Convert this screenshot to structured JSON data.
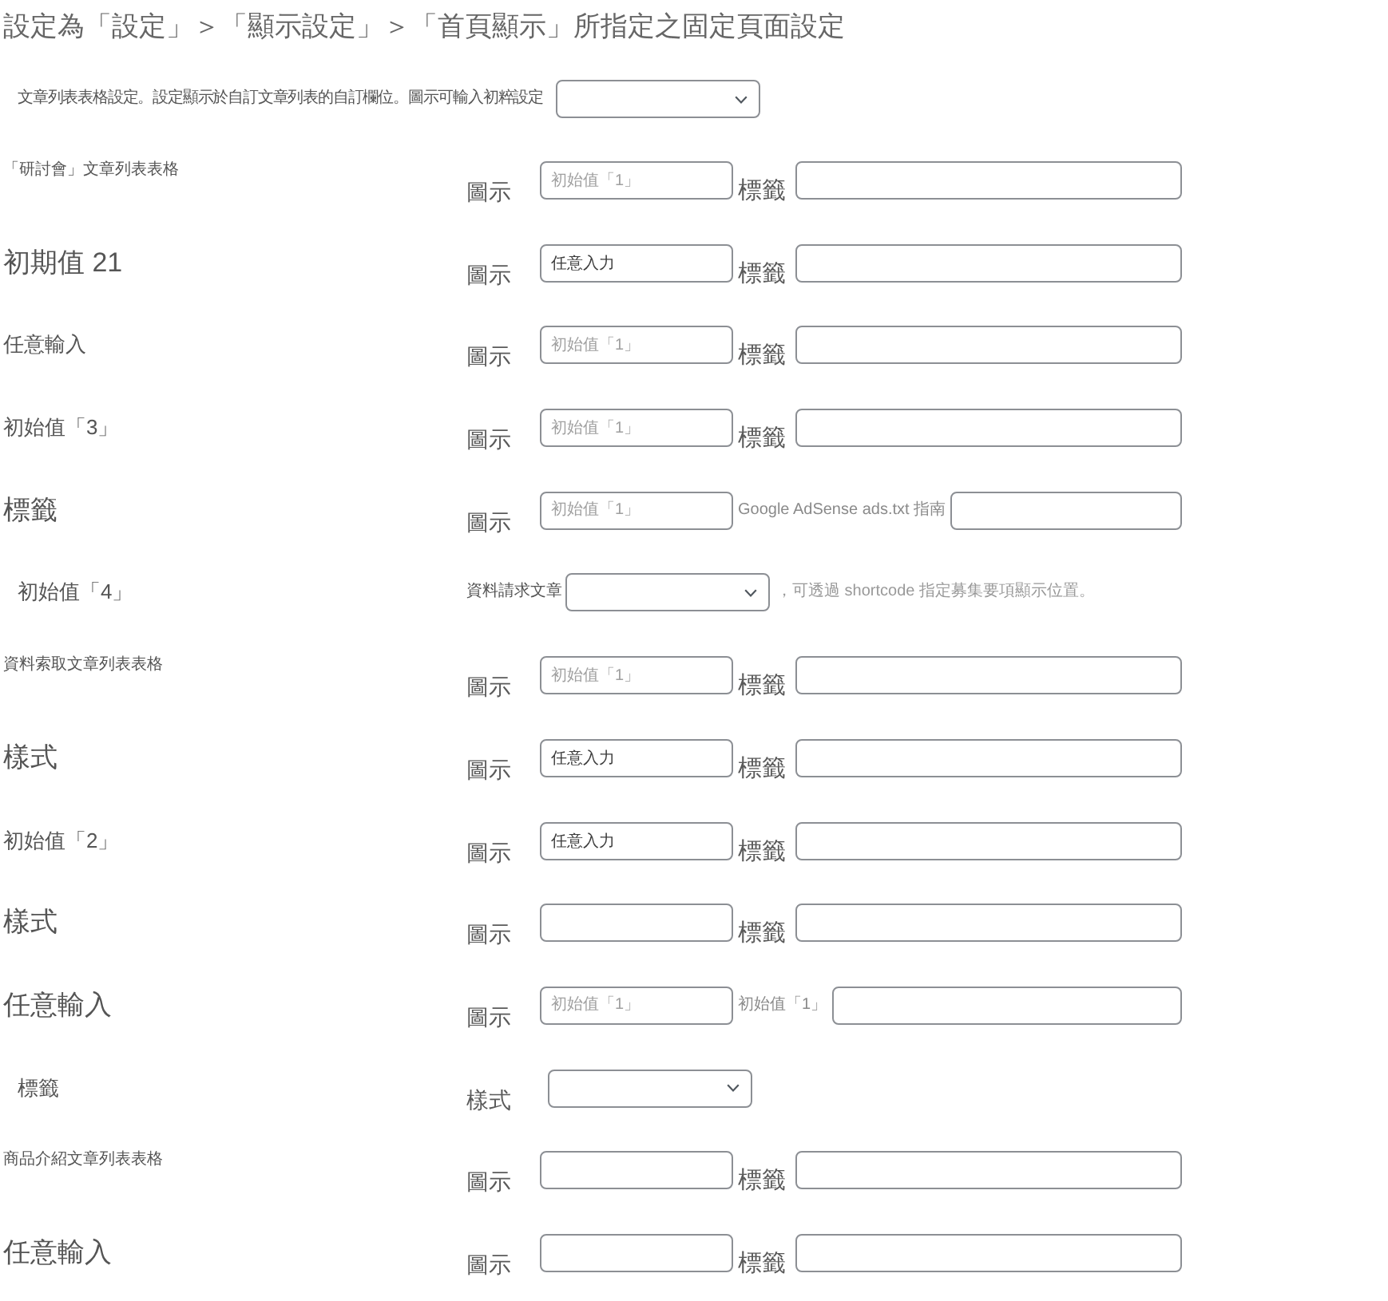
{
  "title": "設定為「設定」＞「顯示設定」＞「首頁顯示」所指定之固定頁面設定",
  "intro": {
    "text": "文章列表表格設定。設定顯示於自訂文章列表的自訂欄位。圖示可輸入初粹設定",
    "dropdown": true
  },
  "rows": [
    {
      "kind": "fields",
      "heading": {
        "text": "「研討會」文章列表表格",
        "kind": "section"
      },
      "icon": {
        "label": {
          "text": "圖示",
          "kind": "label"
        },
        "placeholder": "初始值「1」"
      },
      "tag": {
        "label": {
          "text": "標籤",
          "kind": "label"
        }
      }
    },
    {
      "kind": "fields",
      "heading": {
        "text": "初期值 21",
        "kind": "title"
      },
      "icon": {
        "label": {
          "text": "圖示",
          "kind": "label"
        },
        "value": "任意入力"
      },
      "tag": {
        "label": {
          "text": "標籤",
          "kind": "label"
        }
      }
    },
    {
      "kind": "fields",
      "heading": {
        "text": "任意輸入",
        "kind": "label"
      },
      "icon": {
        "label": {
          "text": "圖示",
          "kind": "label"
        },
        "placeholder": "初始值「1」"
      },
      "tag": {
        "label": {
          "text": "標籤",
          "kind": "label"
        }
      }
    },
    {
      "kind": "fields",
      "heading": {
        "text": "初始值「3」",
        "kind": "label"
      },
      "icon": {
        "label": {
          "text": "圖示",
          "kind": "label"
        },
        "placeholder": "初始值「1」"
      },
      "tag": {
        "label": {
          "text": "標籤",
          "kind": "label"
        }
      }
    },
    {
      "kind": "fields",
      "heading": {
        "text": "標籤",
        "kind": "title"
      },
      "icon": {
        "label": {
          "text": "圖示",
          "kind": "label"
        },
        "placeholder": "初始值「1」"
      },
      "tag": {
        "label": {
          "text": "Google AdSense ads.txt 指南",
          "kind": "hint"
        }
      }
    },
    {
      "kind": "dropdown",
      "heading": {
        "text": "初始值「4」",
        "kind": "label"
      },
      "label": {
        "text": "資料請求文章",
        "kind": "hint"
      },
      "note": "，可透過 shortcode 指定募集要項顯示位置。"
    },
    {
      "kind": "fields",
      "heading": {
        "text": "資料索取文章列表表格",
        "kind": "section"
      },
      "icon": {
        "label": {
          "text": "圖示",
          "kind": "label"
        },
        "placeholder": "初始值「1」"
      },
      "tag": {
        "label": {
          "text": "標籤",
          "kind": "label"
        }
      }
    },
    {
      "kind": "fields",
      "heading": {
        "text": "樣式",
        "kind": "title"
      },
      "icon": {
        "label": {
          "text": "圖示",
          "kind": "label"
        },
        "value": "任意入力"
      },
      "tag": {
        "label": {
          "text": "標籤",
          "kind": "label"
        }
      }
    },
    {
      "kind": "fields",
      "heading": {
        "text": "初始值「2」",
        "kind": "label"
      },
      "icon": {
        "label": {
          "text": "圖示",
          "kind": "label"
        },
        "value": "任意入力"
      },
      "tag": {
        "label": {
          "text": "標籤",
          "kind": "label"
        }
      }
    },
    {
      "kind": "fields",
      "heading": {
        "text": "樣式",
        "kind": "title"
      },
      "icon": {
        "label": {
          "text": "圖示",
          "kind": "label"
        }
      },
      "tag": {
        "label": {
          "text": "標籤",
          "kind": "label"
        }
      }
    },
    {
      "kind": "fields",
      "heading": {
        "text": "任意輸入",
        "kind": "title"
      },
      "icon": {
        "label": {
          "text": "圖示",
          "kind": "label"
        },
        "placeholder": "初始值「1」"
      },
      "tag": {
        "label": {
          "text": "初始值「1」",
          "kind": "hint"
        }
      }
    },
    {
      "kind": "dropdown",
      "heading": {
        "text": "標籤",
        "kind": "label"
      },
      "label": {
        "text": "樣式",
        "kind": "label"
      }
    },
    {
      "kind": "fields",
      "heading": {
        "text": "商品介紹文章列表表格",
        "kind": "section"
      },
      "icon": {
        "label": {
          "text": "圖示",
          "kind": "label"
        }
      },
      "tag": {
        "label": {
          "text": "標籤",
          "kind": "label"
        }
      }
    },
    {
      "kind": "fields",
      "heading": {
        "text": "任意輸入",
        "kind": "title"
      },
      "icon": {
        "label": {
          "text": "圖示",
          "kind": "label"
        }
      },
      "tag": {
        "label": {
          "text": "標籤",
          "kind": "label"
        }
      }
    }
  ]
}
